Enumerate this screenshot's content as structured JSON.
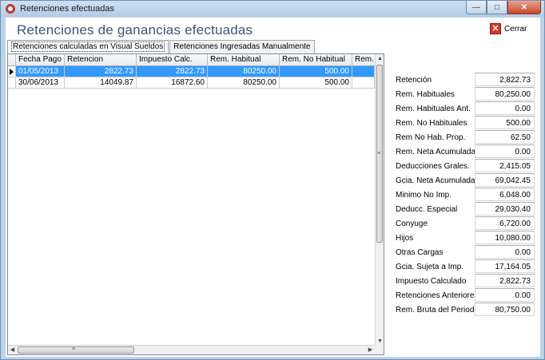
{
  "window": {
    "title": "Retenciones efectuadas"
  },
  "header": {
    "title": "Retenciones de ganancias efectuadas",
    "close_label": "Cerrar"
  },
  "tabs": [
    {
      "label": "Retenciones calculadas en Visual Sueldos",
      "active": true
    },
    {
      "label": "Retenciones Ingresadas Manualmente",
      "active": false
    }
  ],
  "grid": {
    "columns": [
      "Fecha Pago",
      "Retencion",
      "Impuesto Calc.",
      "Rem. Habitual",
      "Rem. No Habitual",
      "Rem."
    ],
    "rows": [
      [
        "01/05/2013",
        "2822.73",
        "2822.73",
        "80250.00",
        "500.00",
        ""
      ],
      [
        "30/06/2013",
        "14049.87",
        "16872.60",
        "80250.00",
        "500.00",
        ""
      ]
    ],
    "selected_row": 0
  },
  "summary": [
    {
      "label": "Retención",
      "value": "2,822.73"
    },
    {
      "label": "Rem. Habituales",
      "value": "80,250.00"
    },
    {
      "label": "Rem. Habituales Ant.",
      "value": "0.00"
    },
    {
      "label": "Rem. No Habituales",
      "value": "500.00"
    },
    {
      "label": "Rem No Hab. Prop.",
      "value": "62.50"
    },
    {
      "label": "Rem. Neta Acumulada",
      "value": "0.00"
    },
    {
      "label": "Deducciones Grales.",
      "value": "2,415.05"
    },
    {
      "label": "Gcia. Neta Acumulada",
      "value": "69,042.45"
    },
    {
      "label": "Minimo No Imp.",
      "value": "6,048.00"
    },
    {
      "label": "Deducc. Especial",
      "value": "29,030.40"
    },
    {
      "label": "Conyuge",
      "value": "6,720.00"
    },
    {
      "label": "Hijos",
      "value": "10,080.00"
    },
    {
      "label": "Otras Cargas",
      "value": "0.00"
    },
    {
      "label": "Gcia. Sujeta a Imp.",
      "value": "17,164.05"
    },
    {
      "label": "Impuesto Calculado",
      "value": "2,822.73"
    },
    {
      "label": "Retenciones Anteriores",
      "value": "0.00"
    },
    {
      "label": "Rem. Bruta del Periodo",
      "value": "80,750.00"
    }
  ],
  "colors": {
    "selection": "#3399ff",
    "heading": "#36567f",
    "close_icon": "#d7371f"
  },
  "icons": {
    "app": "app-icon",
    "minimize": "minimize-icon",
    "maximize": "maximize-icon",
    "close": "close-icon",
    "cerrar": "cerrar-icon"
  }
}
